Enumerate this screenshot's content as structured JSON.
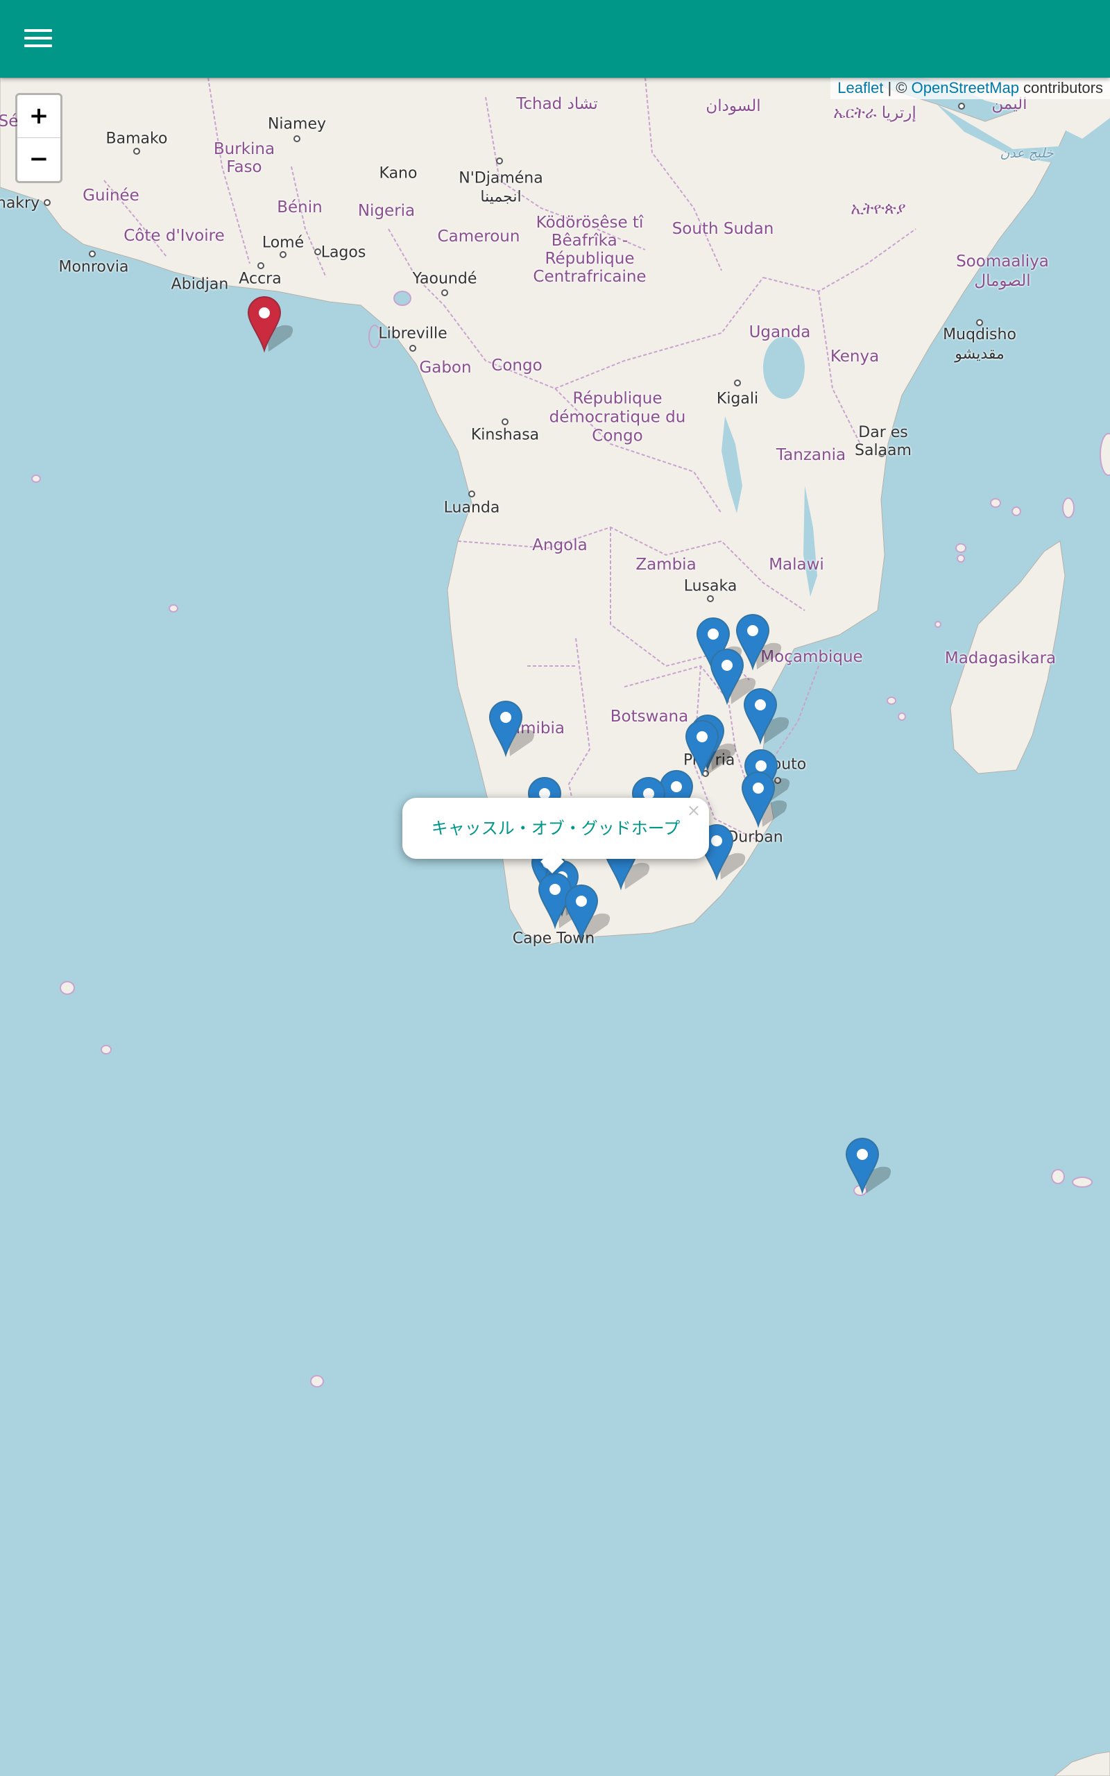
{
  "header": {
    "menu_icon": "hamburger-menu-icon",
    "color": "#009688"
  },
  "map": {
    "zoom_in_label": "+",
    "zoom_out_label": "−",
    "attribution": {
      "leaflet": "Leaflet",
      "separator": " | © ",
      "osm": "OpenStreetMap",
      "suffix": " contributors"
    },
    "popup": {
      "text": "キャッスル・オブ・グッドホープ",
      "close": "×"
    },
    "labels": {
      "senegal": "Sé",
      "bamako": "Bamako",
      "niamey": "Niamey",
      "burkina": "Burkina Faso",
      "kano": "Kano",
      "ndjamena": "N'Djaména",
      "ndjamena_ar": "انجمينا",
      "tchad": "Tchad تشاد",
      "sudan": "السودان",
      "yemen": "اليمن",
      "eritrea": "ኤርትራ إرتريا",
      "aden": "خليج عدن",
      "ethiopia": "ኢትዮጵያ",
      "nakry": "nakry",
      "guinee": "Guinée",
      "benin": "Bénin",
      "nigeria": "Nigeria",
      "kodorosese": "Ködörösêse tî Bêafrîka - République Centrafricaine",
      "south_sudan": "South Sudan",
      "cote": "Côte d'Ivoire",
      "lome": "Lomé",
      "lagos": "Lagos",
      "cameroun": "Cameroun",
      "monrovia": "Monrovia",
      "abidjan": "Abidjan",
      "accra": "Accra",
      "yaounde": "Yaoundé",
      "somalia": "Soomaaliya الصومال",
      "libreville": "Libreville",
      "gabon": "Gabon",
      "congo": "Congo",
      "uganda": "Uganda",
      "muqdisho": "Muqdisho مقديشو",
      "kenya": "Kenya",
      "kigali": "Kigali",
      "rdc": "République démocratique du Congo",
      "kinshasa": "Kinshasa",
      "dar": "Dar es Salaam",
      "tanzania": "Tanzania",
      "luanda": "Luanda",
      "angola": "Angola",
      "zambia": "Zambia",
      "malawi": "Malawi",
      "lusaka": "Lusaka",
      "mocambique": "Moçambique",
      "madagasikara": "Madagasikara",
      "namibia": "amibia",
      "botswana": "Botswana",
      "maputo": "Maputo",
      "pretoria": "Pr",
      "pretoria2": "ria",
      "durban": "Durban",
      "cape_town": "Cape Town"
    },
    "colors": {
      "water": "#aad3df",
      "land": "#f2efe9",
      "border": "#c9a3cf",
      "marker_blue": "#2a81cb",
      "marker_red": "#cb2b3e"
    },
    "marker_icons": {
      "blue": "blue-map-marker-icon",
      "red": "red-map-marker-icon"
    }
  }
}
